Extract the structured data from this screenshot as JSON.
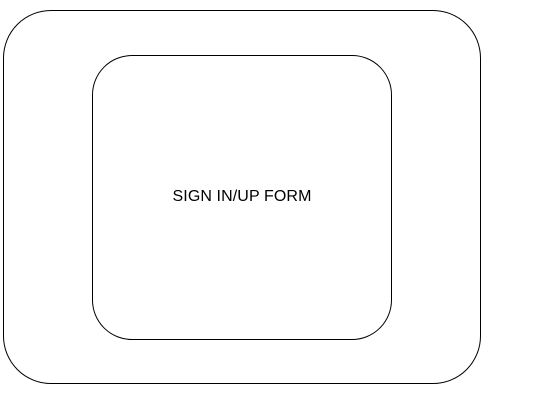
{
  "diagram": {
    "form_box": {
      "label": "SIGN IN/UP FORM"
    }
  }
}
